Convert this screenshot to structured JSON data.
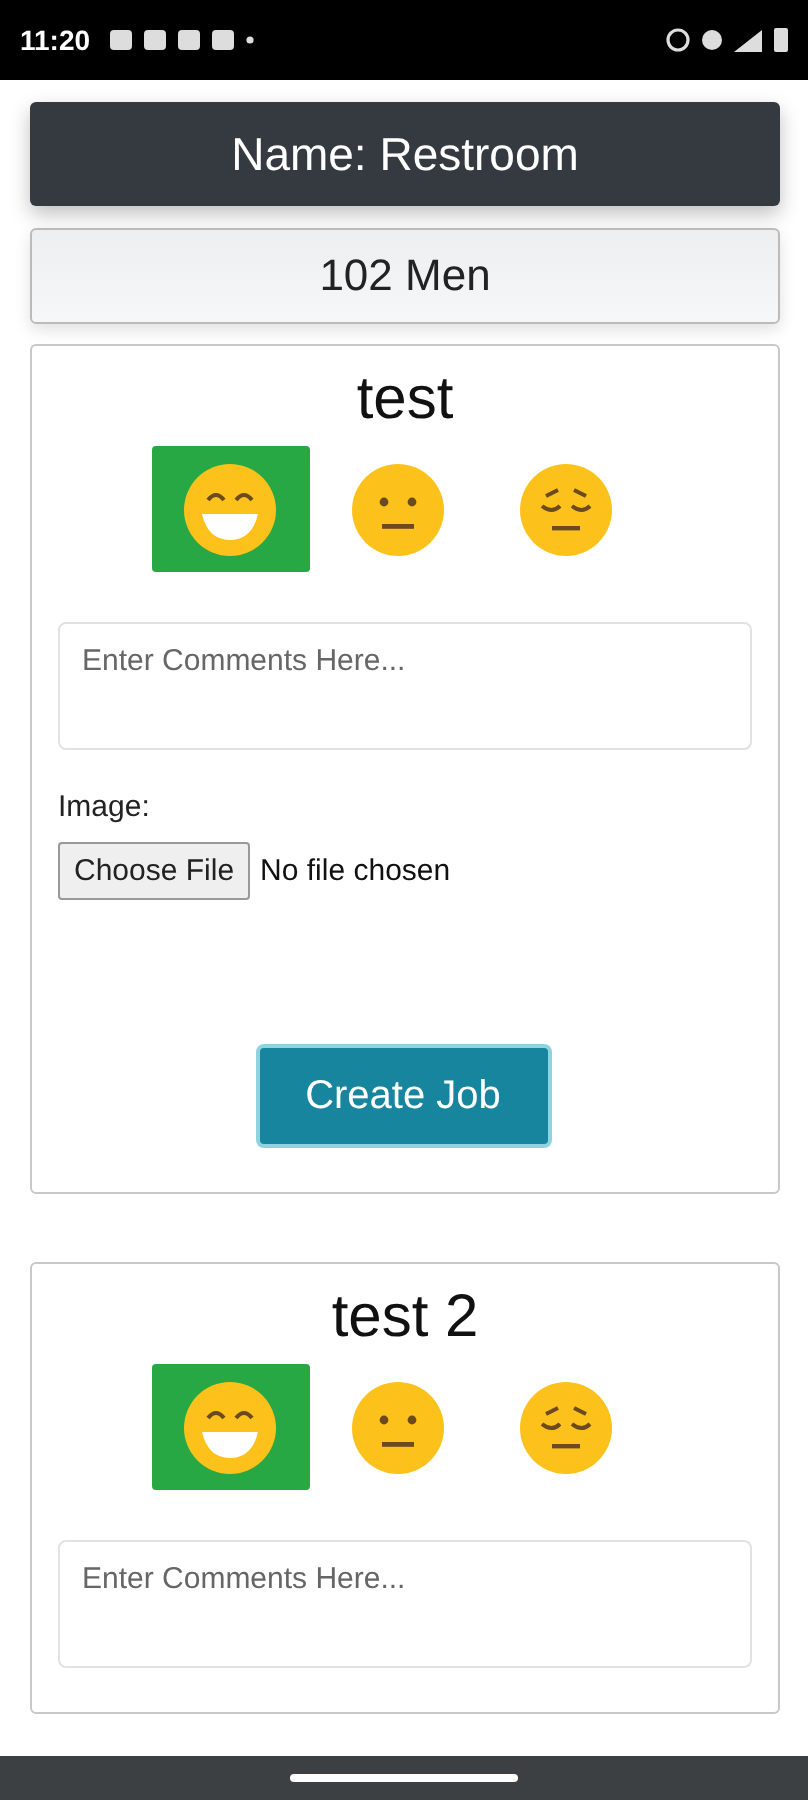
{
  "status_bar": {
    "time": "11:20"
  },
  "header": {
    "title": "Name: Restroom"
  },
  "location": {
    "label": "102 Men"
  },
  "cards": [
    {
      "title": "test",
      "ratings": [
        {
          "kind": "happy",
          "selected": true
        },
        {
          "kind": "neutral",
          "selected": false
        },
        {
          "kind": "sad",
          "selected": false
        }
      ],
      "comment_placeholder": "Enter Comments Here...",
      "image_label": "Image:",
      "file_button": "Choose File",
      "file_status": "No file chosen",
      "submit": "Create Job"
    },
    {
      "title": "test 2",
      "ratings": [
        {
          "kind": "happy",
          "selected": true
        },
        {
          "kind": "neutral",
          "selected": false
        },
        {
          "kind": "sad",
          "selected": false
        }
      ],
      "comment_placeholder": "Enter Comments Here..."
    }
  ]
}
